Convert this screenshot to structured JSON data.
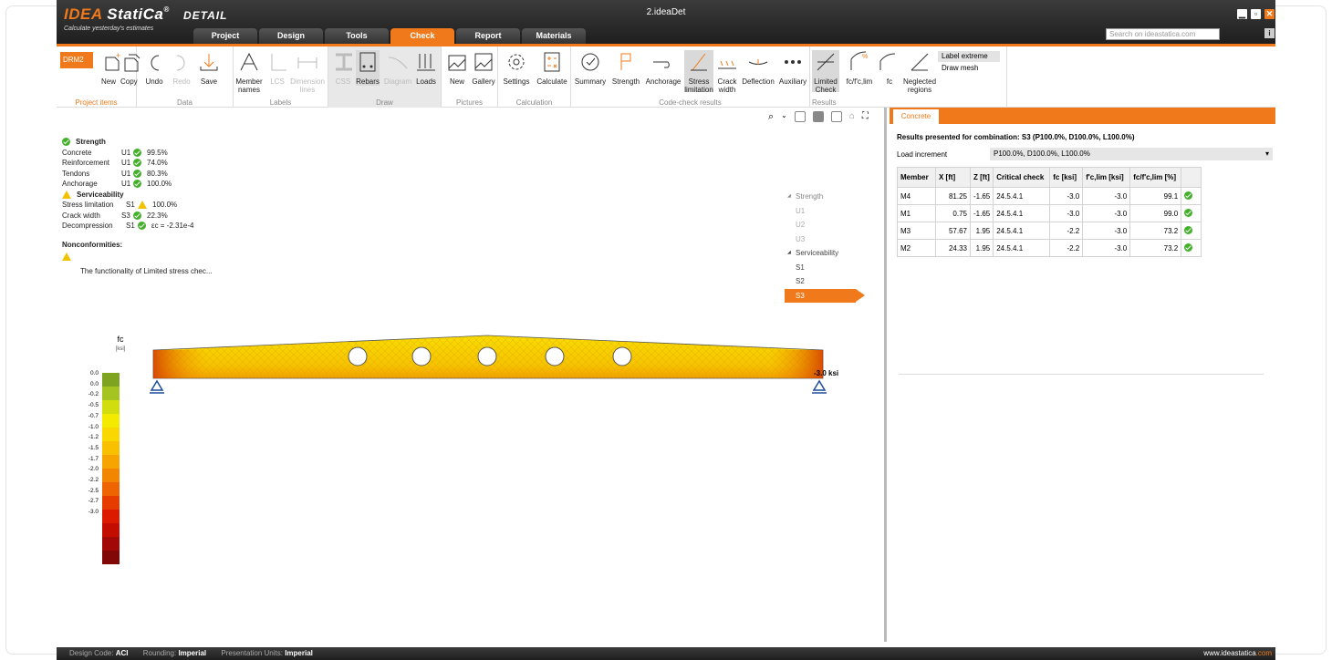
{
  "app": {
    "logo_brand": "IDEA",
    "logo_name": "StatiCa",
    "logo_reg": "®",
    "logo_product": "DETAIL",
    "tagline": "Calculate yesterday's estimates",
    "doc_title": "2.ideaDet",
    "search_placeholder": "Search on ideastatica.com",
    "info": "i"
  },
  "tabs": [
    "Project",
    "Design",
    "Tools",
    "Check",
    "Report",
    "Materials"
  ],
  "ribbon": {
    "drm": "DRM2",
    "groups": {
      "project_items": "Project items",
      "data": "Data",
      "labels": "Labels",
      "draw": "Draw",
      "pictures": "Pictures",
      "calculation": "Calculation",
      "code_check": "Code-check results",
      "results": "Results"
    },
    "buttons": {
      "new": "New",
      "copy": "Copy",
      "undo": "Undo",
      "redo": "Redo",
      "save": "Save",
      "member_names": "Member names",
      "lcs": "LCS",
      "dimension_lines": "Dimension lines",
      "css": "CSS",
      "rebars": "Rebars",
      "diagram": "Diagram",
      "loads": "Loads",
      "pic_new": "New",
      "gallery": "Gallery",
      "settings": "Settings",
      "calculate": "Calculate",
      "summary": "Summary",
      "strength": "Strength",
      "anchorage": "Anchorage",
      "stress_limitation": "Stress limitation",
      "crack_width": "Crack width",
      "deflection": "Deflection",
      "auxiliary": "Auxiliary",
      "limited_check": "Limited Check",
      "fc_ratio": "fc/f'c,lim",
      "fc": "fc",
      "neglected_regions": "Neglected regions",
      "label_extreme": "Label extreme",
      "draw_mesh": "Draw mesh"
    }
  },
  "summary": {
    "strength_header": "Strength",
    "strength_rows": [
      {
        "name": "Concrete",
        "case": "U1",
        "value": "99.5%"
      },
      {
        "name": "Reinforcement",
        "case": "U1",
        "value": "74.0%"
      },
      {
        "name": "Tendons",
        "case": "U1",
        "value": "80.3%"
      },
      {
        "name": "Anchorage",
        "case": "U1",
        "value": "100.0%"
      }
    ],
    "service_header": "Serviceability",
    "service_rows": [
      {
        "name": "Stress limitation",
        "case": "S1",
        "value": "100.0%",
        "status": "warn"
      },
      {
        "name": "Crack width",
        "case": "S3",
        "value": "22.3%",
        "status": "ok"
      },
      {
        "name": "Decompression",
        "case": "S1",
        "value": "εc = -2.31e-4",
        "status": "ok"
      }
    ],
    "nonconf_header": "Nonconformities:",
    "nonconf_msg": "The functionality of Limited stress chec..."
  },
  "tree": {
    "strength": "Strength",
    "strength_items": [
      "U1",
      "U2",
      "U3"
    ],
    "service": "Serviceability",
    "service_items": [
      "S1",
      "S2",
      "S3"
    ],
    "selected": "S3"
  },
  "legend": {
    "title": "fc",
    "unit": "[ksi]",
    "values": [
      "0.0",
      "0.0",
      "-0.2",
      "-0.5",
      "-0.7",
      "-1.0",
      "-1.2",
      "-1.5",
      "-1.7",
      "-2.0",
      "-2.2",
      "-2.5",
      "-2.7",
      "-3.0"
    ],
    "colors": [
      "#7ea320",
      "#a6c421",
      "#d1dd0f",
      "#f4ea00",
      "#f8d800",
      "#f9c000",
      "#f7a300",
      "#f38600",
      "#ee6400",
      "#e63c00",
      "#dc1a00",
      "#c30d00",
      "#a30808",
      "#820707"
    ]
  },
  "beam": {
    "extreme_label": "-3.0 ksi"
  },
  "right": {
    "tab": "Concrete",
    "combination": "Results presented for combination: S3 (P100.0%, D100.0%, L100.0%)",
    "load_increment_label": "Load increment",
    "load_increment_value": "P100.0%, D100.0%, L100.0%",
    "columns": [
      "Member",
      "X [ft]",
      "Z [ft]",
      "Critical check",
      "fc [ksi]",
      "f'c,lim [ksi]",
      "fc/f'c,lim [%]",
      ""
    ],
    "rows": [
      {
        "member": "M4",
        "x": "81.25",
        "z": "-1.65",
        "check": "24.5.4.1",
        "fc": "-3.0",
        "fclim": "-3.0",
        "ratio": "99.1"
      },
      {
        "member": "M1",
        "x": "0.75",
        "z": "-1.65",
        "check": "24.5.4.1",
        "fc": "-3.0",
        "fclim": "-3.0",
        "ratio": "99.0"
      },
      {
        "member": "M3",
        "x": "57.67",
        "z": "1.95",
        "check": "24.5.4.1",
        "fc": "-2.2",
        "fclim": "-3.0",
        "ratio": "73.2"
      },
      {
        "member": "M2",
        "x": "24.33",
        "z": "1.95",
        "check": "24.5.4.1",
        "fc": "-2.2",
        "fclim": "-3.0",
        "ratio": "73.2"
      }
    ]
  },
  "status": {
    "design_code_label": "Design Code:",
    "design_code": "ACI",
    "rounding_label": "Rounding:",
    "rounding": "Imperial",
    "units_label": "Presentation Units:",
    "units": "Imperial",
    "site_main": "www.ideastatica",
    "site_tld": ".com"
  },
  "colors": {
    "accent": "#f07a1b",
    "ok": "#43b02a",
    "warn": "#f2c200"
  }
}
